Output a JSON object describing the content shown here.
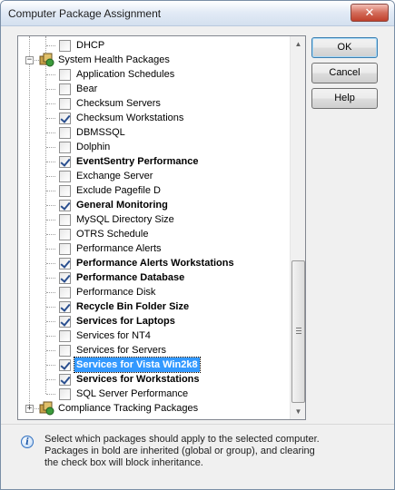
{
  "window": {
    "title": "Computer Package Assignment",
    "close_glyph": "✕"
  },
  "buttons": {
    "ok": "OK",
    "cancel": "Cancel",
    "help": "Help"
  },
  "tree": {
    "items": [
      {
        "label": "DHCP",
        "level": 2,
        "checked": false,
        "bold": false
      },
      {
        "label": "System Health Packages",
        "level": 1,
        "group": true,
        "expanded": true,
        "icon": "package-group-icon"
      },
      {
        "label": "Application Schedules",
        "level": 2,
        "checked": false,
        "bold": false
      },
      {
        "label": "Bear",
        "level": 2,
        "checked": false,
        "bold": false
      },
      {
        "label": "Checksum Servers",
        "level": 2,
        "checked": false,
        "bold": false
      },
      {
        "label": "Checksum Workstations",
        "level": 2,
        "checked": true,
        "bold": false
      },
      {
        "label": "DBMSSQL",
        "level": 2,
        "checked": false,
        "bold": false
      },
      {
        "label": "Dolphin",
        "level": 2,
        "checked": false,
        "bold": false
      },
      {
        "label": "EventSentry Performance",
        "level": 2,
        "checked": true,
        "bold": true
      },
      {
        "label": "Exchange Server",
        "level": 2,
        "checked": false,
        "bold": false
      },
      {
        "label": "Exclude Pagefile D",
        "level": 2,
        "checked": false,
        "bold": false
      },
      {
        "label": "General Monitoring",
        "level": 2,
        "checked": true,
        "bold": true
      },
      {
        "label": "MySQL Directory Size",
        "level": 2,
        "checked": false,
        "bold": false
      },
      {
        "label": "OTRS Schedule",
        "level": 2,
        "checked": false,
        "bold": false
      },
      {
        "label": "Performance Alerts",
        "level": 2,
        "checked": false,
        "bold": false
      },
      {
        "label": "Performance Alerts Workstations",
        "level": 2,
        "checked": true,
        "bold": true
      },
      {
        "label": "Performance Database",
        "level": 2,
        "checked": true,
        "bold": true
      },
      {
        "label": "Performance Disk",
        "level": 2,
        "checked": false,
        "bold": false
      },
      {
        "label": "Recycle Bin Folder Size",
        "level": 2,
        "checked": true,
        "bold": true
      },
      {
        "label": "Services for Laptops",
        "level": 2,
        "checked": true,
        "bold": true
      },
      {
        "label": "Services for NT4",
        "level": 2,
        "checked": false,
        "bold": false
      },
      {
        "label": "Services for Servers",
        "level": 2,
        "checked": false,
        "bold": false
      },
      {
        "label": "Services for Vista Win2k8",
        "level": 2,
        "checked": true,
        "bold": true,
        "selected": true
      },
      {
        "label": "Services for Workstations",
        "level": 2,
        "checked": true,
        "bold": true
      },
      {
        "label": "SQL Server Performance",
        "level": 2,
        "checked": false,
        "bold": false
      },
      {
        "label": "Compliance Tracking Packages",
        "level": 1,
        "group": true,
        "expanded": false,
        "icon": "package-group-icon"
      }
    ]
  },
  "info": {
    "icon": "info-icon",
    "text": "Select which packages should apply to the selected computer. Packages in bold are inherited (global or group), and clearing the check box will block inheritance."
  },
  "colors": {
    "selection": "#3399ff",
    "checkmark": "#2a4f8f"
  }
}
